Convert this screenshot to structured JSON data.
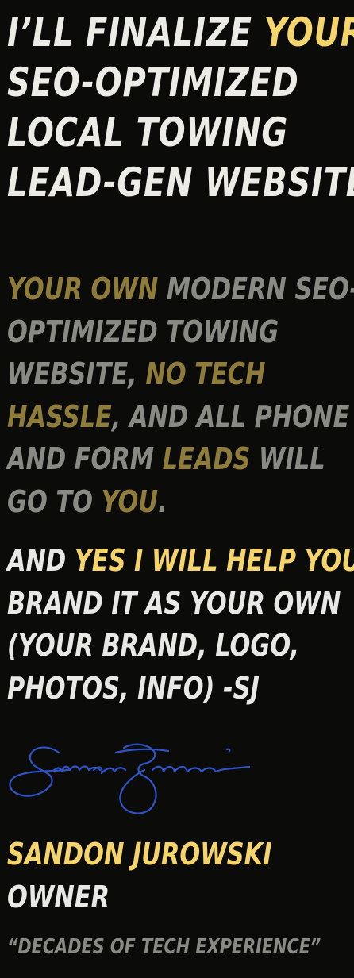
{
  "headline": {
    "line1_pre": "I’LL FINALIZE ",
    "line1_hl": "YOUR",
    "line2": "SEO-OPTIMIZED",
    "line3": "LOCAL TOWING",
    "line4": "LEAD-GEN WEBSITE"
  },
  "sub": {
    "l1_hl": "YOUR OWN",
    "l1_rest": " MODERN SEO-",
    "l2": "OPTIMIZED TOWING",
    "l3_pre": "WEBSITE, ",
    "l3_hl": "NO TECH",
    "l4_hl": "HASSLE",
    "l4_rest": ", AND ALL PHONE",
    "l5_pre": "AND FORM ",
    "l5_hl": "LEADS",
    "l5_rest": " WILL",
    "l6_pre": "GO TO ",
    "l6_hl": "YOU",
    "l6_rest": "."
  },
  "promise": {
    "l1_pre": "AND ",
    "l1_hl": "YES I WILL HELP YOU",
    "l2": "BRAND IT AS YOUR OWN",
    "l3": "(YOUR BRAND, LOGO,",
    "l4": "PHOTOS, INFO)  -SJ"
  },
  "signature": {
    "ink_color": "#2e54c8"
  },
  "owner": {
    "name": "SANDON JUROWSKI",
    "role": "OWNER",
    "quote": "“DECADES OF TECH EXPERIENCE”"
  },
  "colors": {
    "background": "#0b0b09",
    "accent": "#f5d56b",
    "accent_muted": "#8f7c3a",
    "text": "#ecebe6",
    "text_muted": "#8a8a85"
  }
}
